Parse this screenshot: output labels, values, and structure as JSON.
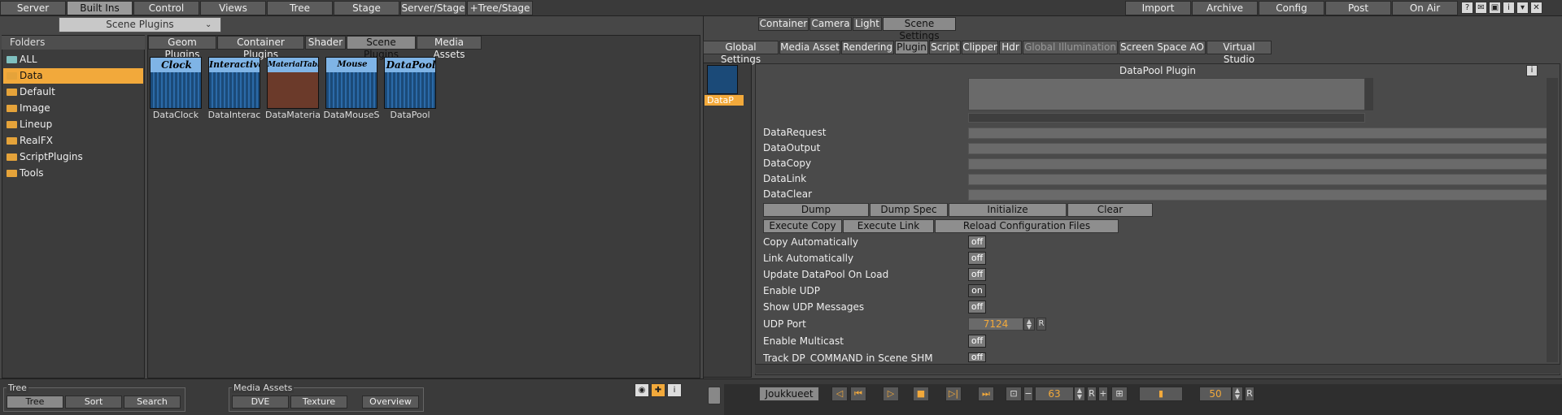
{
  "topbar": {
    "left_items": [
      "Server",
      "Built Ins",
      "Control",
      "Views",
      "Tree",
      "Stage",
      "Server/Stage",
      "+Tree/Stage"
    ],
    "active_left": "Built Ins",
    "right_items": [
      "Import",
      "Archive",
      "Config",
      "Post",
      "On Air"
    ]
  },
  "left": {
    "dropdown": "Scene Plugins",
    "folders_header": "Folders",
    "folders": [
      "ALL",
      "Data",
      "Default",
      "Image",
      "Lineup",
      "RealFX",
      "ScriptPlugins",
      "Tools"
    ],
    "selected_folder": "Data",
    "tabs": [
      "Geom Plugins",
      "Container Plugins",
      "Shader",
      "Scene Plugins",
      "Media Assets"
    ],
    "active_tab": "Scene Plugins",
    "plugins": [
      {
        "title": "Clock",
        "name": "DataClock"
      },
      {
        "title": "Interactive",
        "name": "DataInterac"
      },
      {
        "title": "MaterialTable",
        "name": "DataMateria"
      },
      {
        "title": "Mouse Sensor",
        "name": "DataMouseS"
      },
      {
        "title": "DataPool",
        "name": "DataPool"
      }
    ]
  },
  "bottom": {
    "tree_label": "Tree",
    "tree_buttons": [
      "Tree",
      "Sort",
      "Search"
    ],
    "media_label": "Media Assets",
    "media_buttons": [
      "DVE",
      "Texture",
      "Overview"
    ],
    "joukkueet": "Joukkueet",
    "frame_value": "63",
    "speed_value": "50",
    "r_label": "R"
  },
  "right": {
    "top_tabs": [
      "Container",
      "Camera",
      "Light",
      "Scene Settings"
    ],
    "active_top_tab": "Scene Settings",
    "sub_tabs": [
      "Global Settings",
      "Media Asset",
      "Rendering",
      "Plugin",
      "Script",
      "Clipper",
      "Hdr",
      "Global Illumination",
      "Screen Space AO",
      "Virtual Studio"
    ],
    "active_sub_tab": "Plugin",
    "disabled_sub_tab": "Global Illumination",
    "list_item": "DataP",
    "panel_title": "DataPool Plugin",
    "fields": [
      "DataRequest",
      "DataOutput",
      "DataCopy",
      "DataLink",
      "DataClear"
    ],
    "buttons_row1": [
      "Dump",
      "Dump Spec",
      "Initialize",
      "Clear"
    ],
    "buttons_row2": [
      "Execute Copy",
      "Execute Link",
      "Reload Configuration Files"
    ],
    "toggles": [
      {
        "label": "Copy Automatically",
        "value": "off"
      },
      {
        "label": "Link Automatically",
        "value": "off"
      },
      {
        "label": "Update DataPool On Load",
        "value": "off"
      },
      {
        "label": "Enable UDP",
        "value": "on"
      },
      {
        "label": "Show UDP Messages",
        "value": "off"
      }
    ],
    "udp_port_label": "UDP Port",
    "udp_port": "7124",
    "multicast_label": "Enable Multicast",
    "multicast_value": "off",
    "track_label": "Track DP_COMMAND in Scene SHM",
    "track_value": "off"
  },
  "colors": {
    "accent": "#f2a93b",
    "background": "#474747",
    "panel": "#3c3c3c"
  }
}
